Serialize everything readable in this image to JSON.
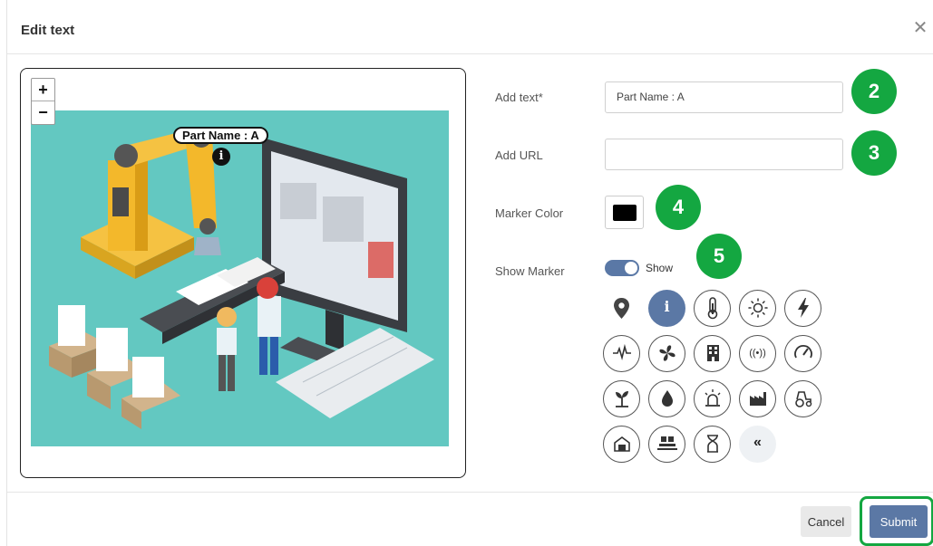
{
  "dialog": {
    "title": "Edit text"
  },
  "preview": {
    "zoom_in": "+",
    "zoom_out": "−",
    "marker_label": "Part Name : A",
    "marker_icon": "i"
  },
  "form": {
    "add_text_label": "Add text*",
    "add_text_value": "Part Name : A",
    "add_url_label": "Add URL",
    "add_url_value": "",
    "marker_color_label": "Marker Color",
    "marker_color_value": "#000000",
    "show_marker_label": "Show Marker",
    "show_marker_toggle_text": "Show",
    "show_marker_on": true
  },
  "badges": [
    "2",
    "3",
    "4",
    "5"
  ],
  "icons": [
    "location-pin",
    "info",
    "thermometer",
    "sun",
    "lightning",
    "pulse",
    "fan",
    "building",
    "signal",
    "gauge",
    "plant",
    "water-drop",
    "alarm-light",
    "factory",
    "tractor",
    "warehouse",
    "truck-loader",
    "hourglass",
    "collapse"
  ],
  "icon_glyphs": {
    "info": "i",
    "collapse": "«"
  },
  "footer": {
    "cancel_label": "Cancel",
    "submit_label": "Submit"
  },
  "colors": {
    "accent": "#5b78a5",
    "badge": "#14a741",
    "scene": "#63c8c1"
  }
}
